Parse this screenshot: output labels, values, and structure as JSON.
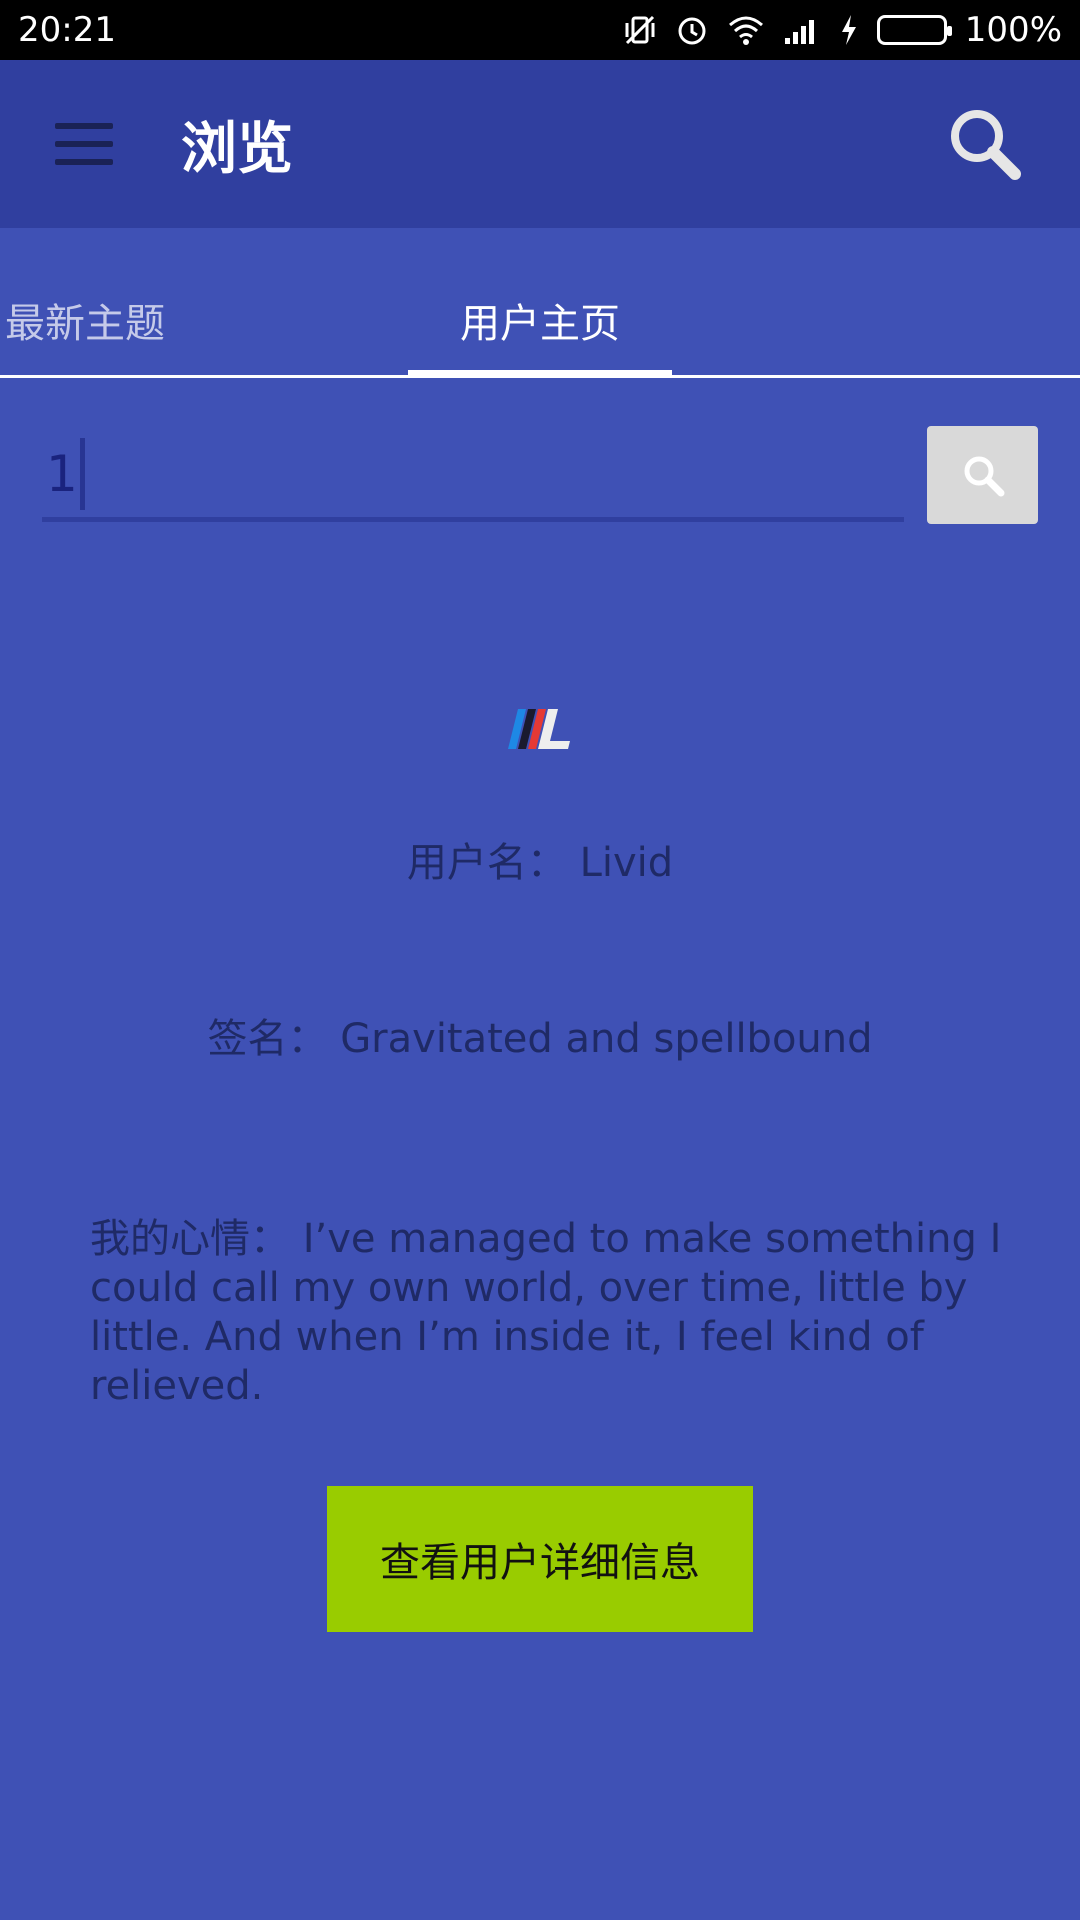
{
  "status_bar": {
    "time": "20:21",
    "battery_percent": "100%",
    "battery_level": 1.0,
    "icons": [
      "vibrate-off-icon",
      "alarm-icon",
      "wifi-icon",
      "signal-icon",
      "charging-icon",
      "battery-icon"
    ]
  },
  "app_bar": {
    "title": "浏览",
    "menu_icon": "hamburger-menu-icon",
    "search_icon": "search-icon"
  },
  "tabs": [
    {
      "label": "最新主题",
      "active": false
    },
    {
      "label": "用户主页",
      "active": true
    }
  ],
  "search": {
    "value": "1",
    "button_icon": "search-icon"
  },
  "profile": {
    "avatar": "user-avatar",
    "username_label": "用户名：",
    "username": "Livid",
    "signature_label": "签名：",
    "signature": "Gravitated and spellbound",
    "mood_label": "我的心情：",
    "mood": "I’ve managed to make something I could call my own world, over time, little by little. And when I’m inside it, I feel kind of relieved."
  },
  "detail_button": {
    "label": "查看用户详细信息"
  },
  "colors": {
    "background": "#3f51b5",
    "app_bar": "#303f9f",
    "button": "#99cc00"
  }
}
